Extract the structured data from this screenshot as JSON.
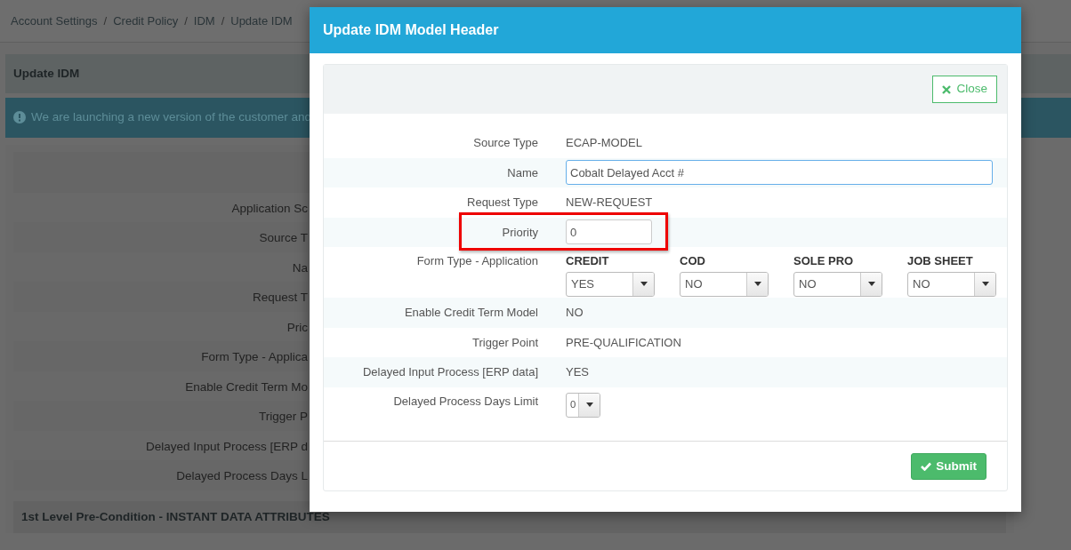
{
  "breadcrumb": [
    {
      "label": "Account Settings"
    },
    {
      "label": "Credit Policy"
    },
    {
      "label": "IDM"
    },
    {
      "label": "Update IDM"
    }
  ],
  "breadcrumb_separators": [
    "/",
    "/",
    "/"
  ],
  "panel_title": "Update IDM",
  "alert": {
    "text": "We are launching a new version of the customer and"
  },
  "background_form": {
    "labels": [
      "Application Sc",
      "Source T",
      "Na",
      "Request T",
      "Pric",
      "Form Type - Applica",
      "Enable Credit Term Mo",
      "Trigger P",
      "Delayed Input Process [ERP d",
      "Delayed Process Days L"
    ],
    "section_title": "1st Level Pre-Condition - INSTANT DATA ATTRIBUTES"
  },
  "modal": {
    "title": "Update IDM Model Header",
    "close_button": "Close",
    "fields": [
      {
        "kind": "text",
        "label": "Source Type",
        "value": "ECAP-MODEL",
        "highlighted": false
      },
      {
        "kind": "input",
        "label": "Name",
        "value": "Cobalt Delayed Acct #",
        "highlighted": false
      },
      {
        "kind": "text",
        "label": "Request Type",
        "value": "NEW-REQUEST",
        "highlighted": false
      },
      {
        "kind": "input",
        "label": "Priority",
        "value": "0",
        "highlighted": true
      },
      {
        "kind": "selects",
        "label": "Form Type - Application",
        "highlighted": false,
        "options": [
          {
            "heading": "CREDIT",
            "value": "YES"
          },
          {
            "heading": "COD",
            "value": "NO"
          },
          {
            "heading": "SOLE PRO",
            "value": "NO"
          },
          {
            "heading": "JOB SHEET",
            "value": "NO"
          }
        ]
      },
      {
        "kind": "text",
        "label": "Enable Credit Term Model",
        "value": "NO",
        "highlighted": false
      },
      {
        "kind": "text",
        "label": "Trigger Point",
        "value": "PRE-QUALIFICATION",
        "highlighted": false
      },
      {
        "kind": "text",
        "label": "Delayed Input Process [ERP data]",
        "value": "YES",
        "highlighted": false
      },
      {
        "kind": "select",
        "label": "Delayed Process Days Limit",
        "value": "0",
        "highlighted": false
      }
    ],
    "submit_button": "Submit"
  }
}
